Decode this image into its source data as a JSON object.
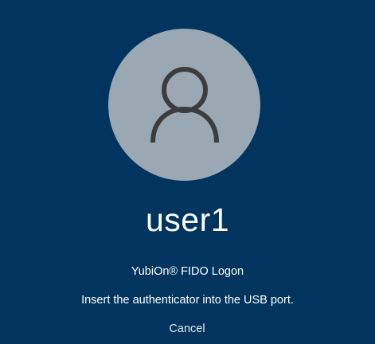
{
  "user": {
    "name": "user1",
    "avatar_icon": "user-silhouette-icon"
  },
  "credential_provider": {
    "title": "YubiOn® FIDO Logon",
    "message": "Insert the authenticator into the USB port."
  },
  "actions": {
    "cancel_label": "Cancel"
  },
  "colors": {
    "background": "#01345f",
    "avatar_circle": "#9aa8b4",
    "icon_stroke": "#3c3c3c",
    "text": "#ffffff"
  }
}
